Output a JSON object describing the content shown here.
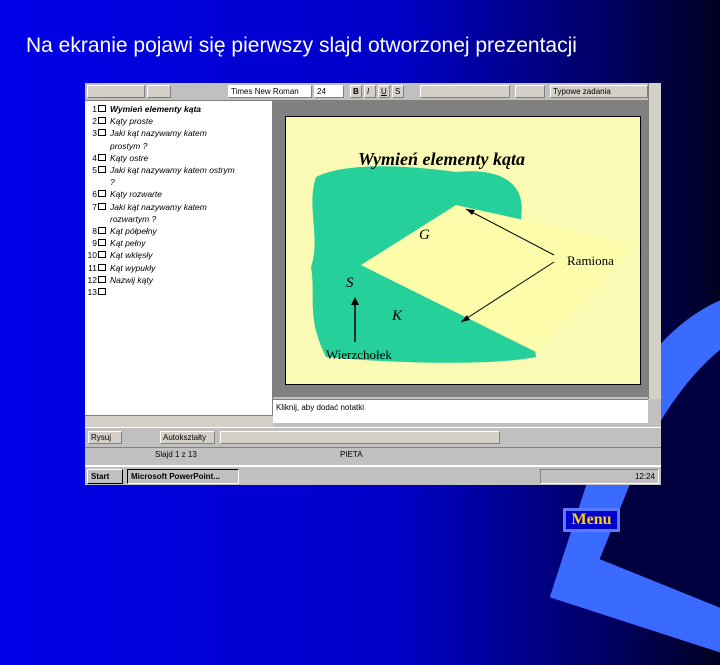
{
  "slide": {
    "title": "Na ekranie pojawi się pierwszy slajd otworzonej prezentacji",
    "menu_label": "Menu"
  },
  "toolbar": {
    "font": "Times New Roman",
    "size": "24",
    "bold": "B",
    "italic": "I",
    "underline": "U",
    "shadow": "S",
    "tasks": "Typowe zadania"
  },
  "outline": {
    "items": [
      {
        "num": "1",
        "text": "Wymień elementy kąta",
        "bold": true
      },
      {
        "num": "2",
        "text": "Kąty proste"
      },
      {
        "num": "3",
        "text": "Jaki kąt nazywamy katem"
      },
      {
        "num": "",
        "text": "prostym ?",
        "indent": true
      },
      {
        "num": "4",
        "text": "Kąty ostre"
      },
      {
        "num": "5",
        "text": "Jaki kąt nazywamy katem ostrym"
      },
      {
        "num": "",
        "text": "?",
        "indent": true
      },
      {
        "num": "6",
        "text": "Kąty rozwarte"
      },
      {
        "num": "7",
        "text": "Jaki kąt nazywamy katem"
      },
      {
        "num": "",
        "text": "rozwartym ?",
        "indent": true
      },
      {
        "num": "8",
        "text": "Kąt półpełny"
      },
      {
        "num": "9",
        "text": "Kąt pełny"
      },
      {
        "num": "10",
        "text": "Kąt wklęsły"
      },
      {
        "num": "11",
        "text": "Kąt wypukły"
      },
      {
        "num": "12",
        "text": "Nazwij kąty"
      },
      {
        "num": "13",
        "text": ""
      }
    ]
  },
  "preview": {
    "heading": "Wymień elementy kąta",
    "label_g": "G",
    "label_s": "S",
    "label_k": "K",
    "label_ramiona": "Ramiona",
    "label_wierzcholek": "Wierzchołek",
    "colors": {
      "blob": "#26d09a",
      "triangle": "#fcfcaa",
      "background": "#fafab4"
    }
  },
  "notes": {
    "placeholder": "Kliknij, aby dodać notatki"
  },
  "drawbar": {
    "draw": "Rysuj",
    "autoshapes": "Autokształty"
  },
  "status": {
    "slide": "Slajd 1 z 13",
    "design": "PIETA"
  },
  "taskbar": {
    "start": "Start",
    "app": "Microsoft PowerPoint...",
    "time": "12:24"
  }
}
